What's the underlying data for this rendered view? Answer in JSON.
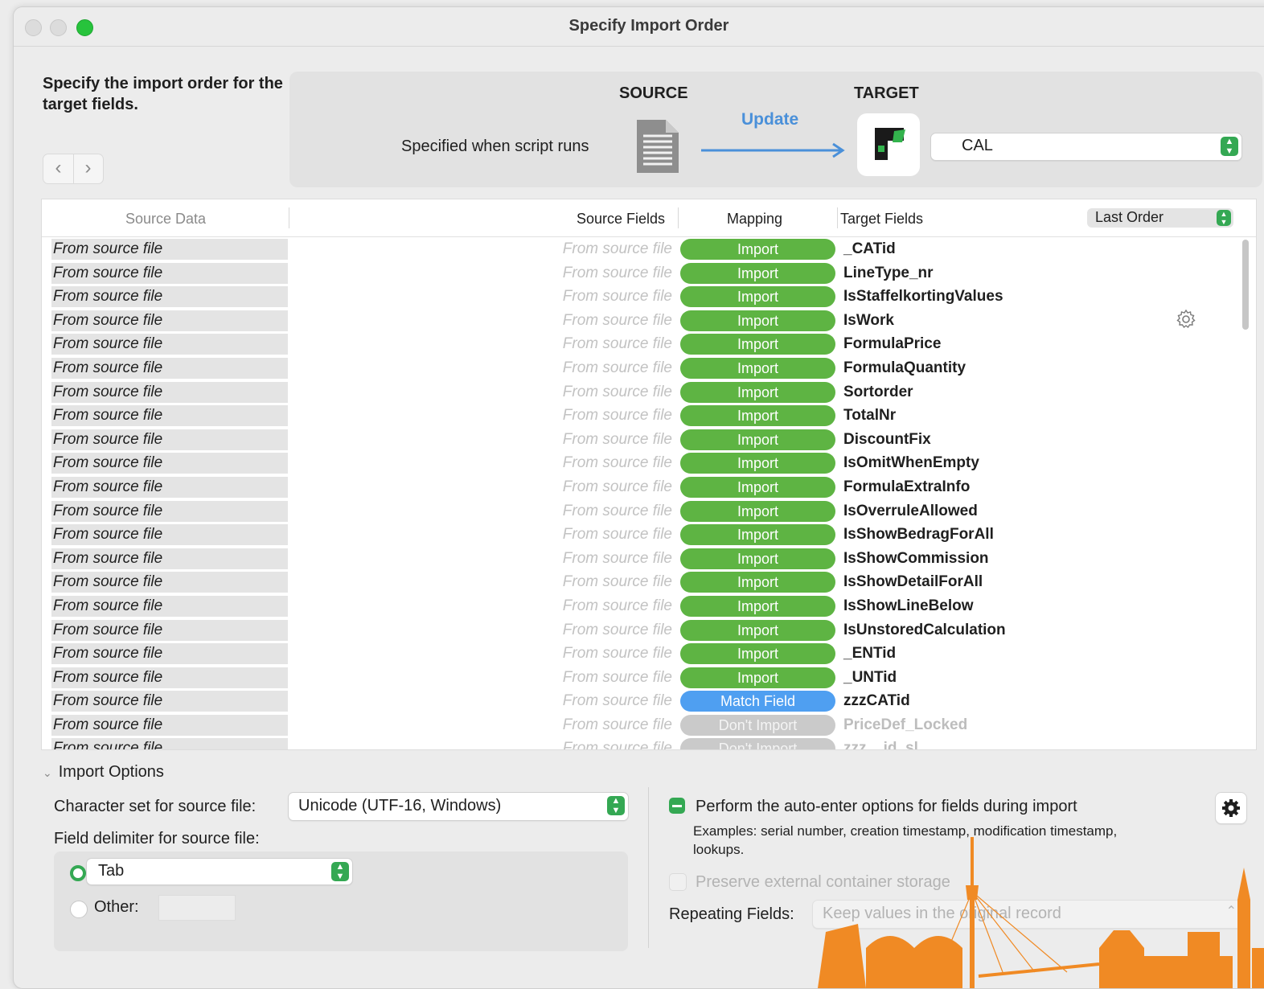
{
  "window": {
    "title": "Specify Import Order"
  },
  "heading": "Specify the import order for the target fields.",
  "nav": {
    "back": "‹",
    "forward": "›"
  },
  "source_target": {
    "source_label": "SOURCE",
    "target_label": "TARGET",
    "source_desc": "Specified when script runs",
    "action": "Update",
    "target_table": "CAL"
  },
  "table": {
    "headers": {
      "source_data": "Source Data",
      "source_fields": "Source Fields",
      "mapping": "Mapping",
      "target_fields": "Target Fields"
    },
    "order_select": "Last Order",
    "rows": [
      {
        "data": "From source file",
        "field": "From source file",
        "mapping": "Import",
        "target": "_CATid"
      },
      {
        "data": "From source file",
        "field": "From source file",
        "mapping": "Import",
        "target": "LineType_nr"
      },
      {
        "data": "From source file",
        "field": "From source file",
        "mapping": "Import",
        "target": "IsStaffelkortingValues"
      },
      {
        "data": "From source file",
        "field": "From source file",
        "mapping": "Import",
        "target": "IsWork"
      },
      {
        "data": "From source file",
        "field": "From source file",
        "mapping": "Import",
        "target": "FormulaPrice"
      },
      {
        "data": "From source file",
        "field": "From source file",
        "mapping": "Import",
        "target": "FormulaQuantity"
      },
      {
        "data": "From source file",
        "field": "From source file",
        "mapping": "Import",
        "target": "Sortorder"
      },
      {
        "data": "From source file",
        "field": "From source file",
        "mapping": "Import",
        "target": "TotalNr"
      },
      {
        "data": "From source file",
        "field": "From source file",
        "mapping": "Import",
        "target": "DiscountFix"
      },
      {
        "data": "From source file",
        "field": "From source file",
        "mapping": "Import",
        "target": "IsOmitWhenEmpty"
      },
      {
        "data": "From source file",
        "field": "From source file",
        "mapping": "Import",
        "target": "FormulaExtraInfo"
      },
      {
        "data": "From source file",
        "field": "From source file",
        "mapping": "Import",
        "target": "IsOverruleAllowed"
      },
      {
        "data": "From source file",
        "field": "From source file",
        "mapping": "Import",
        "target": "IsShowBedragForAll"
      },
      {
        "data": "From source file",
        "field": "From source file",
        "mapping": "Import",
        "target": "IsShowCommission"
      },
      {
        "data": "From source file",
        "field": "From source file",
        "mapping": "Import",
        "target": "IsShowDetailForAll"
      },
      {
        "data": "From source file",
        "field": "From source file",
        "mapping": "Import",
        "target": "IsShowLineBelow"
      },
      {
        "data": "From source file",
        "field": "From source file",
        "mapping": "Import",
        "target": "IsUnstoredCalculation"
      },
      {
        "data": "From source file",
        "field": "From source file",
        "mapping": "Import",
        "target": "_ENTid"
      },
      {
        "data": "From source file",
        "field": "From source file",
        "mapping": "Import",
        "target": "_UNTid"
      },
      {
        "data": "From source file",
        "field": "From source file",
        "mapping": "Match Field",
        "target": "zzzCATid"
      },
      {
        "data": "From source file",
        "field": "From source file",
        "mapping": "Don't Import",
        "target": "PriceDef_Locked"
      },
      {
        "data": "From source file",
        "field": "From source file",
        "mapping": "Don't Import",
        "target": "zzz__id_sl"
      }
    ]
  },
  "import_options": {
    "title": "Import Options",
    "charset_label": "Character set for source file:",
    "charset_value": "Unicode (UTF-16, Windows)",
    "delimiter_label": "Field delimiter for source file:",
    "delimiter_tab": "Tab",
    "delimiter_other": "Other:",
    "auto_enter_label": "Perform the auto-enter options for fields during import",
    "auto_enter_examples": "Examples: serial number, creation timestamp, modification timestamp, lookups.",
    "preserve_label": "Preserve external container storage",
    "repeating_label": "Repeating Fields:",
    "repeating_value": "Keep values in the original record"
  },
  "colors": {
    "import": "#5eb443",
    "match": "#4f9ff1",
    "dont_import": "#cacaca",
    "accent_green": "#34a853",
    "arrow_blue": "#4a90d9",
    "watermark": "#f08a24"
  }
}
